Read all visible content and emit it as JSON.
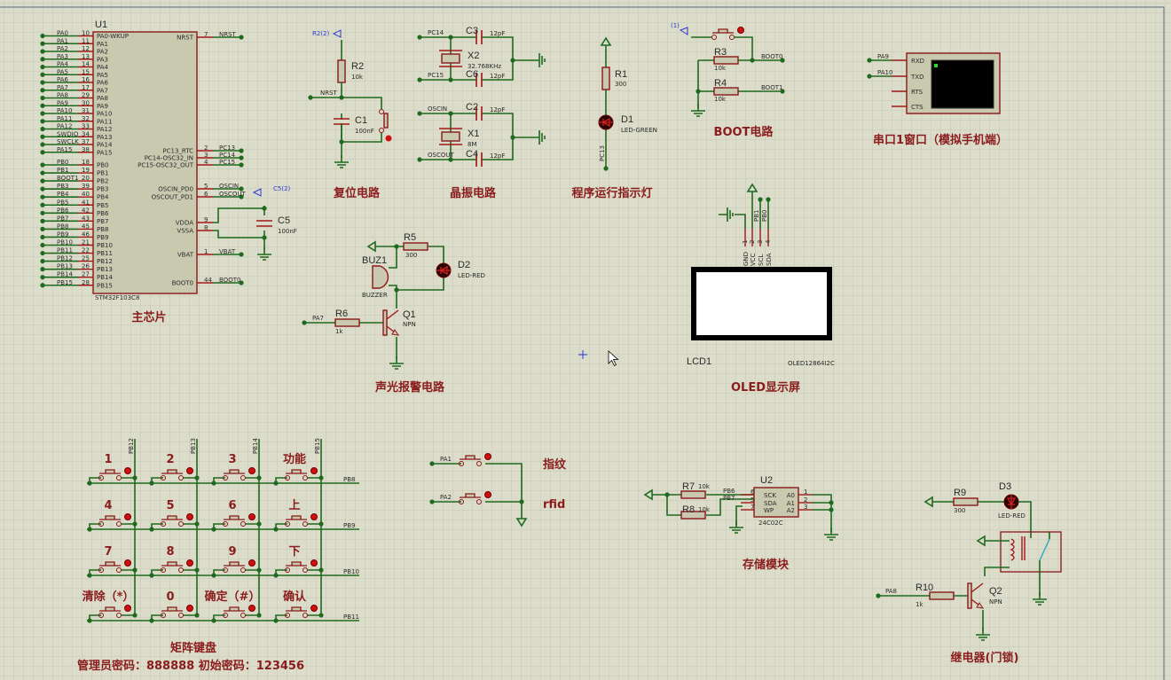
{
  "colors": {
    "wire": "#1e6a1e",
    "component": "#8a1818",
    "background": "#dcdccb",
    "title": "#8a1c1c",
    "led_green": "#1f8a1f"
  },
  "u1": {
    "ref": "U1",
    "part": "STM32F103C8",
    "left": [
      [
        "PA0",
        "10",
        "PA0-WKUP"
      ],
      [
        "PA1",
        "11",
        "PA1"
      ],
      [
        "PA2",
        "12",
        "PA2"
      ],
      [
        "PA3",
        "13",
        "PA3"
      ],
      [
        "PA4",
        "14",
        "PA4"
      ],
      [
        "PA5",
        "15",
        "PA5"
      ],
      [
        "PA6",
        "16",
        "PA6"
      ],
      [
        "PA7",
        "17",
        "PA7"
      ],
      [
        "PA8",
        "29",
        "PA8"
      ],
      [
        "PA9",
        "30",
        "PA9"
      ],
      [
        "PA10",
        "31",
        "PA10"
      ],
      [
        "PA11",
        "32",
        "PA11"
      ],
      [
        "PA12",
        "33",
        "PA12"
      ],
      [
        "SWDIO",
        "34",
        "PA13"
      ],
      [
        "SWCLK",
        "37",
        "PA14"
      ],
      [
        "PA15",
        "38",
        "PA15"
      ],
      [
        "PB0",
        "18",
        "PB0"
      ],
      [
        "PB1",
        "19",
        "PB1"
      ],
      [
        "BOOT1",
        "20",
        "PB2"
      ],
      [
        "PB3",
        "39",
        "PB3"
      ],
      [
        "PB4",
        "40",
        "PB4"
      ],
      [
        "PB5",
        "41",
        "PB5"
      ],
      [
        "PB6",
        "42",
        "PB6"
      ],
      [
        "PB7",
        "43",
        "PB7"
      ],
      [
        "PB8",
        "45",
        "PB8"
      ],
      [
        "PB9",
        "46",
        "PB9"
      ],
      [
        "PB10",
        "21",
        "PB10"
      ],
      [
        "PB11",
        "22",
        "PB11"
      ],
      [
        "PB12",
        "25",
        "PB12"
      ],
      [
        "PB13",
        "26",
        "PB13"
      ],
      [
        "PB14",
        "27",
        "PB14"
      ],
      [
        "PB15",
        "28",
        "PB15"
      ]
    ],
    "right": [
      [
        "NRST",
        "7",
        "NRST"
      ],
      [
        "PC13",
        "2",
        "PC13_RTC"
      ],
      [
        "PC14",
        "3",
        "PC14-OSC32_IN"
      ],
      [
        "PC15",
        "4",
        "PC15-OSC32_OUT"
      ],
      [
        "OSCIN",
        "5",
        "OSCIN_PD0"
      ],
      [
        "OSCOUT",
        "6",
        "OSCOUT_PD1"
      ],
      [
        "",
        "9",
        "VDDA"
      ],
      [
        "",
        "8",
        "VSSA"
      ],
      [
        "VBAT",
        "1",
        "VBAT"
      ],
      [
        "BOOT0",
        "44",
        "BOOT0"
      ]
    ],
    "title": "主芯片"
  },
  "c5": {
    "ref": "C5",
    "value": "100nF",
    "probe": "C5(2)"
  },
  "reset": {
    "probe": "R2(2)",
    "r_ref": "R2",
    "r_val": "10k",
    "net": "NRST",
    "c_ref": "C1",
    "c_val": "100nF",
    "title": "复位电路"
  },
  "crystal": {
    "n1": "PC14",
    "n2": "PC15",
    "n3": "OSCIN",
    "n4": "OSCOUT",
    "c3": "C3",
    "c6": "C6",
    "c2": "C2",
    "c4": "C4",
    "cval": "12pF",
    "x2": "X2",
    "x2v": "32.768KHz",
    "x1": "X1",
    "x1v": "8M",
    "title": "晶振电路"
  },
  "indicator": {
    "r_ref": "R1",
    "r_val": "300",
    "d_ref": "D1",
    "d_val": "LED-GREEN",
    "net": "PC13",
    "title": "程序运行指示灯"
  },
  "boot": {
    "probe": "(1)",
    "r3": "R3",
    "r4": "R4",
    "rval": "10k",
    "n0": "BOOT0",
    "n1": "BOOT1",
    "title": "BOOT电路"
  },
  "serial": {
    "n1": "PA9",
    "n2": "PA10",
    "pins": [
      "RXD",
      "TXD",
      "RTS",
      "CTS"
    ],
    "title": "串口1窗口（模拟手机端）"
  },
  "oled": {
    "pins": [
      "GND",
      "VCC",
      "SCL",
      "SDA"
    ],
    "nums": [
      "1",
      "2",
      "3",
      "4"
    ],
    "nets": [
      "PB1",
      "PB0"
    ],
    "ref": "LCD1",
    "part": "OLED12864I2C",
    "title": "OLED显示屏"
  },
  "alarm": {
    "r5": "R5",
    "r5v": "300",
    "d2": "D2",
    "d2v": "LED-RED",
    "buz": "BUZ1",
    "buzv": "BUZZER",
    "r6": "R6",
    "r6v": "1k",
    "net": "PA7",
    "q": "Q1",
    "qv": "NPN",
    "title": "声光报警电路"
  },
  "keypad": {
    "cols": [
      "PB12",
      "PB13",
      "PB14",
      "PB15"
    ],
    "rows": [
      "PB8",
      "PB9",
      "PB10",
      "PB11"
    ],
    "keys": [
      "1",
      "2",
      "3",
      "功能",
      "4",
      "5",
      "6",
      "上",
      "7",
      "8",
      "9",
      "下",
      "清除（*）",
      "0",
      "确定（#）",
      "确认"
    ],
    "title": "矩阵键盘",
    "passwords": "管理员密码：888888   初始密码：123456"
  },
  "auth": {
    "n1": "PA1",
    "n2": "PA2",
    "l1": "指纹",
    "l2": "rfid"
  },
  "eeprom": {
    "ref": "U2",
    "part": "24C02C",
    "r7": "R7",
    "r8": "R8",
    "rval": "10k",
    "n1": "PB6",
    "n2": "PB7",
    "lpins": [
      [
        "6",
        "SCK"
      ],
      [
        "5",
        "SDA"
      ],
      [
        "7",
        "WP"
      ]
    ],
    "rpins": [
      [
        "1",
        "A0"
      ],
      [
        "2",
        "A1"
      ],
      [
        "3",
        "A2"
      ]
    ],
    "title": "存储模块"
  },
  "relay": {
    "r9": "R9",
    "r9v": "300",
    "d3": "D3",
    "d3v": "LED-RED",
    "r10": "R10",
    "r10v": "1k",
    "net": "PA8",
    "q": "Q2",
    "qv": "NPN",
    "title": "继电器(门锁)"
  }
}
